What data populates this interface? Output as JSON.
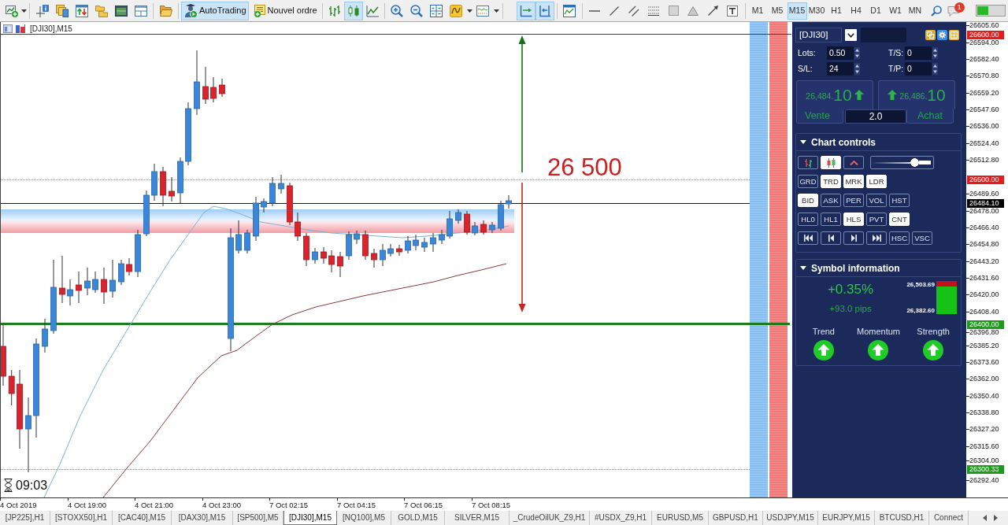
{
  "toolbar": {
    "auto_trading": {
      "label": "AutoTrading",
      "on": true
    },
    "new_order": {
      "label": "Nouvel ordre"
    },
    "chart_types": [
      {
        "kind": "bars",
        "selected": false
      },
      {
        "kind": "candles",
        "selected": true
      },
      {
        "kind": "line",
        "selected": false
      }
    ],
    "chart_options": [
      {
        "kind": "autoscroll",
        "on": true
      },
      {
        "kind": "shift",
        "on": true
      }
    ],
    "timeframes": [
      {
        "label": "M1",
        "selected": false
      },
      {
        "label": "M5",
        "selected": false
      },
      {
        "label": "M15",
        "selected": true
      },
      {
        "label": "M30",
        "selected": false
      },
      {
        "label": "H1",
        "selected": false
      },
      {
        "label": "H4",
        "selected": false
      },
      {
        "label": "D1",
        "selected": false
      },
      {
        "label": "W1",
        "selected": false
      },
      {
        "label": "MN",
        "selected": false
      }
    ],
    "notification_count": "1"
  },
  "chart": {
    "title": "[DJI30],M15",
    "annotation": "26 500",
    "timer": "09:03",
    "price_ticks": [
      "26605.60",
      "26594.00",
      "26582.40",
      "26570.80",
      "26559.20",
      "26547.60",
      "26536.00",
      "26524.40",
      "26512.80",
      "26489.60",
      "26478.00",
      "26466.40",
      "26454.80",
      "26443.20",
      "26431.60",
      "26420.00",
      "26408.40",
      "26396.80",
      "26385.20",
      "26373.60",
      "26362.00",
      "26350.40",
      "26338.80",
      "26327.20",
      "26315.60",
      "26304.00",
      "26292.40"
    ],
    "price_markers": [
      {
        "label": "26600.00",
        "color": "#e01e1e"
      },
      {
        "label": "26500.00",
        "color": "#e01e1e"
      },
      {
        "label": "26484.10",
        "color": "#000000"
      },
      {
        "label": "26400.00",
        "color": "#1f9a1f"
      },
      {
        "label": "26300.33",
        "color": "#1f9a1f"
      }
    ],
    "time_labels": [
      "4 Oct 2019",
      "4 Oct 19:00",
      "4 Oct 21:00",
      "4 Oct 23:00",
      "7 Oct 02:15",
      "7 Oct 04:15",
      "7 Oct 06:15",
      "7 Oct 08:15"
    ]
  },
  "trade_panel": {
    "symbol": "[DJI30]",
    "fields": [
      {
        "label": "Lots:",
        "value": "0.50"
      },
      {
        "label": "T/S:",
        "value": "0"
      },
      {
        "label": "S/L:",
        "value": "24"
      },
      {
        "label": "T/P:",
        "value": "0"
      }
    ],
    "sell": {
      "price": "26,484.",
      "pips": "10",
      "label": "Vente"
    },
    "buy": {
      "price": "26,486.",
      "pips": "10",
      "label": "Achat"
    },
    "volume": "2.0"
  },
  "chart_controls": {
    "title": "Chart controls",
    "expanded": true,
    "rows": [
      [
        {
          "kind": "bars",
          "on": false
        },
        {
          "kind": "candles",
          "on": true
        },
        {
          "kind": "caret",
          "on": false
        },
        {
          "kind": "slider",
          "level": 0.77
        }
      ],
      [
        {
          "kind": "text",
          "label": "GRD",
          "on": false
        },
        {
          "kind": "text",
          "label": "TRD",
          "on": true
        },
        {
          "kind": "text",
          "label": "MRK",
          "on": true
        },
        {
          "kind": "text",
          "label": "LDR",
          "on": true
        }
      ],
      [
        {
          "kind": "text",
          "label": "BID",
          "on": true
        },
        {
          "kind": "text",
          "label": "ASK",
          "on": false
        },
        {
          "kind": "text",
          "label": "PER",
          "on": false
        },
        {
          "kind": "text",
          "label": "VOL",
          "on": false
        },
        {
          "kind": "text",
          "label": "HST",
          "on": false
        }
      ],
      [
        {
          "kind": "text",
          "label": "HL0",
          "on": false
        },
        {
          "kind": "text",
          "label": "HL1",
          "on": false
        },
        {
          "kind": "text",
          "label": "HLS",
          "on": true
        },
        {
          "kind": "text",
          "label": "PVT",
          "on": false
        },
        {
          "kind": "text",
          "label": "CNT",
          "on": true
        }
      ],
      [
        {
          "kind": "first"
        },
        {
          "kind": "prev"
        },
        {
          "kind": "next"
        },
        {
          "kind": "last"
        },
        {
          "kind": "text",
          "label": "HSC",
          "on": false
        },
        {
          "kind": "text",
          "label": "VSC",
          "on": false
        }
      ]
    ]
  },
  "symbol_info": {
    "title": "Symbol information",
    "expanded": true,
    "change": "+0.35%",
    "pips": "+93.0 pips",
    "high": "26,503.69",
    "low": "26,382.60",
    "level": 0.83,
    "indicators": [
      {
        "label": "Trend",
        "rising": true
      },
      {
        "label": "Momentum",
        "rising": true
      },
      {
        "label": "Strength",
        "rising": true
      }
    ]
  },
  "tabs": [
    {
      "label": "[JP225],H1",
      "selected": false
    },
    {
      "label": "[STOXX50],H1",
      "selected": false
    },
    {
      "label": "[CAC40],M15",
      "selected": false
    },
    {
      "label": "[DAX30],M15",
      "selected": false
    },
    {
      "label": "[SP500],M5",
      "selected": false
    },
    {
      "label": "[DJI30],M15",
      "selected": true
    },
    {
      "label": "[NQ100],M5",
      "selected": false
    },
    {
      "label": "GOLD,M15",
      "selected": false
    },
    {
      "label": "SILVER,M15",
      "selected": false
    },
    {
      "label": "_CrudeOilUK_Z9,H1",
      "selected": false
    },
    {
      "label": "#USDX_Z9,H1",
      "selected": false
    },
    {
      "label": "EURUSD,M5",
      "selected": false
    },
    {
      "label": "GBPUSD,H1",
      "selected": false
    },
    {
      "label": "USDJPY,M15",
      "selected": false
    },
    {
      "label": "EURJPY,M15",
      "selected": false
    },
    {
      "label": "BTCUSD,H1",
      "selected": false
    },
    {
      "label": "Connect",
      "selected": false
    }
  ]
}
